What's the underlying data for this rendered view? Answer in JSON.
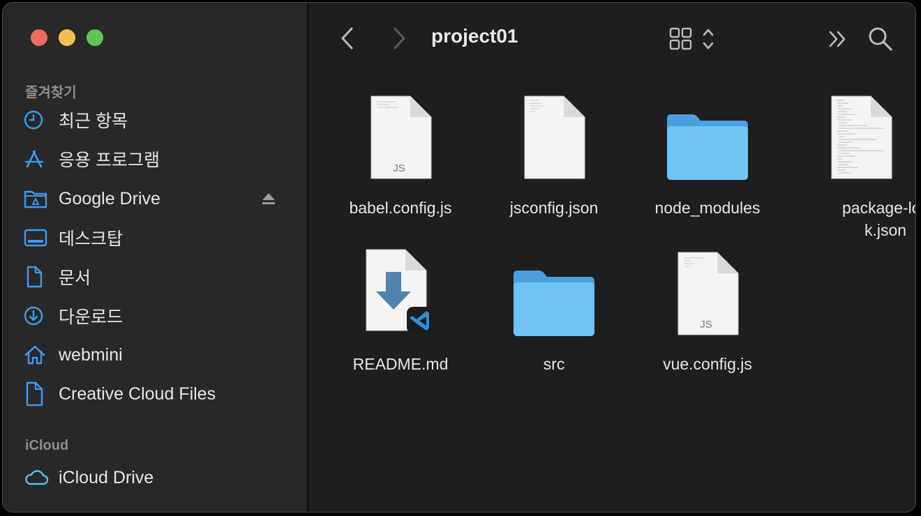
{
  "window": {
    "title": "project01"
  },
  "sidebar": {
    "favorites_title": "즐겨찾기",
    "favorites": [
      {
        "label": "최근 항목",
        "icon": "clock-icon"
      },
      {
        "label": "응용 프로그램",
        "icon": "applications-icon"
      },
      {
        "label": "Google Drive",
        "icon": "google-drive-folder-icon"
      },
      {
        "label": "데스크탑",
        "icon": "desktop-icon"
      },
      {
        "label": "문서",
        "icon": "document-icon"
      },
      {
        "label": "다운로드",
        "icon": "download-icon"
      },
      {
        "label": "webmini",
        "icon": "home-icon"
      },
      {
        "label": "Creative Cloud Files",
        "icon": "file-icon"
      }
    ],
    "icloud_title": "iCloud",
    "icloud": [
      {
        "label": "iCloud Drive",
        "icon": "cloud-icon"
      }
    ]
  },
  "files": [
    {
      "name": "babel.config.js",
      "type": "js",
      "badge": "JS"
    },
    {
      "name": "jsconfig.json",
      "type": "doc"
    },
    {
      "name": "node_modules",
      "type": "folder"
    },
    {
      "name": "package-lock.json",
      "type": "doc-dense"
    },
    {
      "name": "README.md",
      "type": "markdown"
    },
    {
      "name": "src",
      "type": "folder"
    },
    {
      "name": "vue.config.js",
      "type": "js",
      "badge": "JS"
    }
  ],
  "colors": {
    "accent": "#3b9cf5",
    "folder": "#6fc3f5"
  }
}
